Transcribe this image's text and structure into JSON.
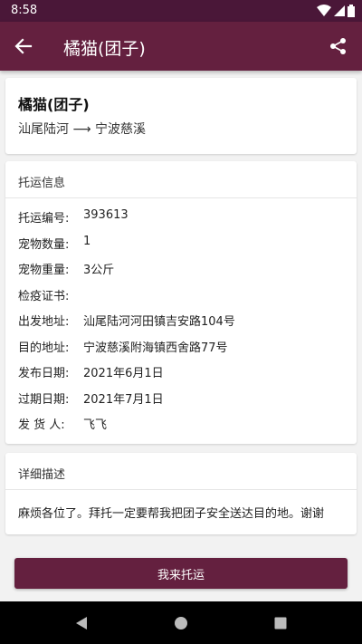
{
  "status_bar": {
    "time": "8:58",
    "icons": [
      "wifi-icon",
      "signal-icon",
      "battery-icon"
    ]
  },
  "app_bar": {
    "title": "橘猫(团子)",
    "back_icon": "arrow-left-icon",
    "share_icon": "share-icon"
  },
  "summary": {
    "pet_name": "橘猫(团子)",
    "route": "汕尾陆河 ⟶ 宁波慈溪"
  },
  "info": {
    "header": "托运信息",
    "rows": [
      {
        "label": "托运编号:",
        "value": "393613"
      },
      {
        "label": "宠物数量:",
        "value": "1"
      },
      {
        "label": "宠物重量:",
        "value": "3公斤"
      },
      {
        "label": "检疫证书:",
        "value": ""
      },
      {
        "label": "出发地址:",
        "value": "汕尾陆河河田镇吉安路104号"
      },
      {
        "label": "目的地址:",
        "value": "宁波慈溪附海镇西舍路77号"
      },
      {
        "label": "发布日期:",
        "value": "2021年6月1日"
      },
      {
        "label": "过期日期:",
        "value": "2021年7月1日"
      },
      {
        "label": "发 货 人:",
        "value": "飞飞"
      }
    ]
  },
  "description": {
    "header": "详细描述",
    "text": "麻烦各位了。拜托一定要帮我把团子安全送达目的地。谢谢"
  },
  "action": {
    "label": "我来托运"
  },
  "colors": {
    "primary": "#64203f",
    "primary_dark": "#4a1738",
    "background": "#f2f2f2"
  }
}
